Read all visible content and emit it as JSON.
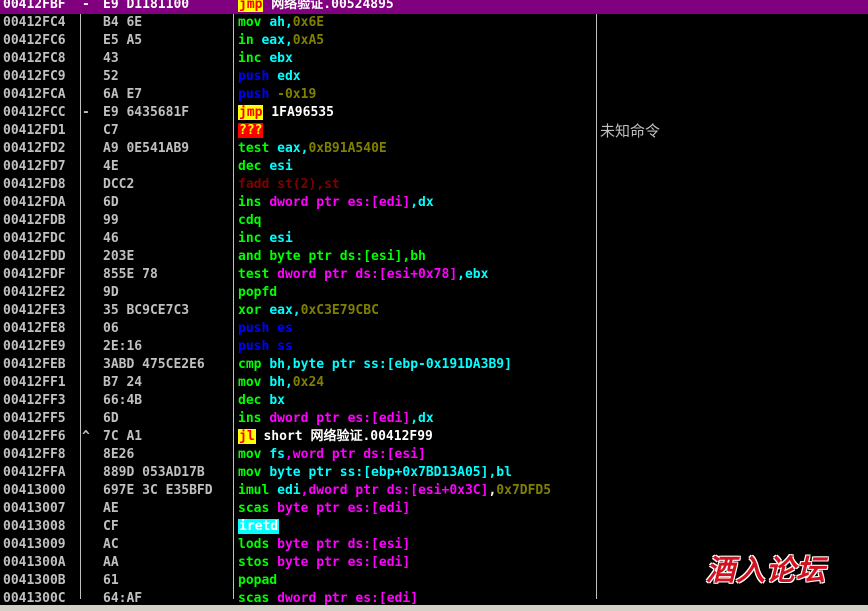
{
  "colors": {
    "background": "#000000",
    "selected_row": "#800080",
    "address": "#c0c0c0",
    "mnemonic_default": "#ffffff",
    "operand_register": "#00ffff",
    "operand_immediate": "#808000",
    "ptr_keyword": "#ff00ff",
    "push_pop": "#0000ff",
    "jump_highlight_bg": "#ffff00",
    "jump_highlight_fg": "#ff0000",
    "unknown_bg": "#ff0000",
    "unknown_fg": "#ffff00",
    "fpu": "#800000",
    "iretd_bg": "#00ffff",
    "iretd_fg": "#ffffff",
    "scas": "#00ff00",
    "watermark": "#d4111e"
  },
  "rows": [
    {
      "addr": "00412FBF",
      "mark": "-",
      "hex": "E9 D1181100",
      "selected": true,
      "ins": [
        {
          "t": "jmp",
          "c": "#ff0000",
          "bg": "#ffff00"
        },
        {
          "t": " 网络验证.00524895",
          "c": "#ffffff"
        }
      ],
      "cmt": ""
    },
    {
      "addr": "00412FC4",
      "mark": "",
      "hex": "B4 6E",
      "ins": [
        {
          "t": "mov ",
          "c": "#00ff00"
        },
        {
          "t": "ah",
          "c": "#00ffff"
        },
        {
          "t": ",",
          "c": "#00ffff"
        },
        {
          "t": "0x6E",
          "c": "#808000"
        }
      ],
      "cmt": ""
    },
    {
      "addr": "00412FC6",
      "mark": "",
      "hex": "E5 A5",
      "ins": [
        {
          "t": "in ",
          "c": "#00ff00"
        },
        {
          "t": "eax",
          "c": "#00ffff"
        },
        {
          "t": ",",
          "c": "#00ffff"
        },
        {
          "t": "0xA5",
          "c": "#808000"
        }
      ],
      "cmt": ""
    },
    {
      "addr": "00412FC8",
      "mark": "",
      "hex": "43",
      "ins": [
        {
          "t": "inc ",
          "c": "#00ff00"
        },
        {
          "t": "ebx",
          "c": "#00ffff"
        }
      ],
      "cmt": ""
    },
    {
      "addr": "00412FC9",
      "mark": "",
      "hex": "52",
      "ins": [
        {
          "t": "push ",
          "c": "#0000ff"
        },
        {
          "t": "edx",
          "c": "#00ffff"
        }
      ],
      "cmt": ""
    },
    {
      "addr": "00412FCA",
      "mark": "",
      "hex": "6A E7",
      "ins": [
        {
          "t": "push ",
          "c": "#0000ff"
        },
        {
          "t": "-0x19",
          "c": "#808000"
        }
      ],
      "cmt": ""
    },
    {
      "addr": "00412FCC",
      "mark": "-",
      "hex": "E9 6435681F",
      "ins": [
        {
          "t": "jmp",
          "c": "#ff0000",
          "bg": "#ffff00"
        },
        {
          "t": " 1FA96535",
          "c": "#ffffff"
        }
      ],
      "cmt": ""
    },
    {
      "addr": "00412FD1",
      "mark": "",
      "hex": "C7",
      "ins": [
        {
          "t": "???",
          "c": "#ffff00",
          "bg": "#ff0000"
        }
      ],
      "cmt": "未知命令"
    },
    {
      "addr": "00412FD2",
      "mark": "",
      "hex": "A9 0E541AB9",
      "ins": [
        {
          "t": "test ",
          "c": "#00ff00"
        },
        {
          "t": "eax",
          "c": "#00ffff"
        },
        {
          "t": ",",
          "c": "#00ffff"
        },
        {
          "t": "0xB91A540E",
          "c": "#808000"
        }
      ],
      "cmt": ""
    },
    {
      "addr": "00412FD7",
      "mark": "",
      "hex": "4E",
      "ins": [
        {
          "t": "dec ",
          "c": "#00ff00"
        },
        {
          "t": "esi",
          "c": "#00ffff"
        }
      ],
      "cmt": ""
    },
    {
      "addr": "00412FD8",
      "mark": "",
      "hex": "DCC2",
      "ins": [
        {
          "t": "fadd st(2),st",
          "c": "#800000"
        }
      ],
      "cmt": ""
    },
    {
      "addr": "00412FDA",
      "mark": "",
      "hex": "6D",
      "ins": [
        {
          "t": "ins ",
          "c": "#00ff00"
        },
        {
          "t": "dword ptr es:[edi]",
          "c": "#ff00ff"
        },
        {
          "t": ",dx",
          "c": "#00ffff"
        }
      ],
      "cmt": ""
    },
    {
      "addr": "00412FDB",
      "mark": "",
      "hex": "99",
      "ins": [
        {
          "t": "cdq",
          "c": "#00ff00"
        }
      ],
      "cmt": ""
    },
    {
      "addr": "00412FDC",
      "mark": "",
      "hex": "46",
      "ins": [
        {
          "t": "inc ",
          "c": "#00ff00"
        },
        {
          "t": "esi",
          "c": "#00ffff"
        }
      ],
      "cmt": ""
    },
    {
      "addr": "00412FDD",
      "mark": "",
      "hex": "203E",
      "ins": [
        {
          "t": "and ",
          "c": "#00ff00"
        },
        {
          "t": "byte ptr ds:[esi]",
          "c": "#00ff00"
        },
        {
          "t": ",bh",
          "c": "#00ff00"
        }
      ],
      "cmt": ""
    },
    {
      "addr": "00412FDF",
      "mark": "",
      "hex": "855E 78",
      "ins": [
        {
          "t": "test ",
          "c": "#00ff00"
        },
        {
          "t": "dword ptr ds:[esi+0x78]",
          "c": "#ff00ff"
        },
        {
          "t": ",ebx",
          "c": "#00ffff"
        }
      ],
      "cmt": ""
    },
    {
      "addr": "00412FE2",
      "mark": "",
      "hex": "9D",
      "ins": [
        {
          "t": "popfd",
          "c": "#00ff00"
        }
      ],
      "cmt": ""
    },
    {
      "addr": "00412FE3",
      "mark": "",
      "hex": "35 BC9CE7C3",
      "ins": [
        {
          "t": "xor ",
          "c": "#00ff00"
        },
        {
          "t": "eax",
          "c": "#00ffff"
        },
        {
          "t": ",",
          "c": "#00ffff"
        },
        {
          "t": "0xC3E79CBC",
          "c": "#808000"
        }
      ],
      "cmt": ""
    },
    {
      "addr": "00412FE8",
      "mark": "",
      "hex": "06",
      "ins": [
        {
          "t": "push ",
          "c": "#0000ff"
        },
        {
          "t": "es",
          "c": "#0000ff"
        }
      ],
      "cmt": ""
    },
    {
      "addr": "00412FE9",
      "mark": "",
      "hex": "2E:16",
      "ins": [
        {
          "t": "push ",
          "c": "#0000ff"
        },
        {
          "t": "ss",
          "c": "#0000ff"
        }
      ],
      "cmt": ""
    },
    {
      "addr": "00412FEB",
      "mark": "",
      "hex": "3ABD 475CE2E6",
      "ins": [
        {
          "t": "cmp ",
          "c": "#00ff00"
        },
        {
          "t": "bh",
          "c": "#00ffff"
        },
        {
          "t": ",byte ptr ss:[ebp-0x191DA3B9]",
          "c": "#00ffff"
        }
      ],
      "cmt": ""
    },
    {
      "addr": "00412FF1",
      "mark": "",
      "hex": "B7 24",
      "ins": [
        {
          "t": "mov ",
          "c": "#00ff00"
        },
        {
          "t": "bh",
          "c": "#00ffff"
        },
        {
          "t": ",",
          "c": "#00ffff"
        },
        {
          "t": "0x24",
          "c": "#808000"
        }
      ],
      "cmt": ""
    },
    {
      "addr": "00412FF3",
      "mark": "",
      "hex": "66:4B",
      "ins": [
        {
          "t": "dec ",
          "c": "#00ff00"
        },
        {
          "t": "bx",
          "c": "#00ffff"
        }
      ],
      "cmt": ""
    },
    {
      "addr": "00412FF5",
      "mark": "",
      "hex": "6D",
      "ins": [
        {
          "t": "ins ",
          "c": "#00ff00"
        },
        {
          "t": "dword ptr es:[edi]",
          "c": "#ff00ff"
        },
        {
          "t": ",dx",
          "c": "#00ffff"
        }
      ],
      "cmt": ""
    },
    {
      "addr": "00412FF6",
      "mark": "^",
      "hex": "7C A1",
      "ins": [
        {
          "t": "jl",
          "c": "#ff0000",
          "bg": "#ffff00"
        },
        {
          "t": " short 网络验证.00412F99",
          "c": "#ffffff"
        }
      ],
      "cmt": ""
    },
    {
      "addr": "00412FF8",
      "mark": "",
      "hex": "8E26",
      "ins": [
        {
          "t": "mov ",
          "c": "#00ff00"
        },
        {
          "t": "fs",
          "c": "#00ffff"
        },
        {
          "t": ",word ptr ds:[esi]",
          "c": "#ff00ff"
        }
      ],
      "cmt": ""
    },
    {
      "addr": "00412FFA",
      "mark": "",
      "hex": "889D 053AD17B",
      "ins": [
        {
          "t": "mov ",
          "c": "#00ff00"
        },
        {
          "t": "byte ptr ss:[ebp+0x7BD13A05]",
          "c": "#00ffff"
        },
        {
          "t": ",bl",
          "c": "#00ffff"
        }
      ],
      "cmt": ""
    },
    {
      "addr": "00413000",
      "mark": "",
      "hex": "697E 3C E35BFD",
      "ins": [
        {
          "t": "imul ",
          "c": "#00ff00"
        },
        {
          "t": "edi",
          "c": "#00ffff"
        },
        {
          "t": ",dword ptr ds:[esi+0x3C]",
          "c": "#ff00ff"
        },
        {
          "t": ",",
          "c": "#ffffff"
        },
        {
          "t": "0x7DFD5",
          "c": "#808000"
        }
      ],
      "cmt": ""
    },
    {
      "addr": "00413007",
      "mark": "",
      "hex": "AE",
      "ins": [
        {
          "t": "scas ",
          "c": "#00ff00"
        },
        {
          "t": "byte ptr es:[edi]",
          "c": "#ff00ff"
        }
      ],
      "cmt": ""
    },
    {
      "addr": "00413008",
      "mark": "",
      "hex": "CF",
      "ins": [
        {
          "t": "iretd",
          "c": "#ffffff",
          "bg": "#00ffff"
        }
      ],
      "cmt": ""
    },
    {
      "addr": "00413009",
      "mark": "",
      "hex": "AC",
      "ins": [
        {
          "t": "lods ",
          "c": "#00ff00"
        },
        {
          "t": "byte ptr ds:[esi]",
          "c": "#ff00ff"
        }
      ],
      "cmt": ""
    },
    {
      "addr": "0041300A",
      "mark": "",
      "hex": "AA",
      "ins": [
        {
          "t": "stos ",
          "c": "#00ff00"
        },
        {
          "t": "byte ptr es:[edi]",
          "c": "#ff00ff"
        }
      ],
      "cmt": ""
    },
    {
      "addr": "0041300B",
      "mark": "",
      "hex": "61",
      "ins": [
        {
          "t": "popad",
          "c": "#00ff00"
        }
      ],
      "cmt": ""
    },
    {
      "addr": "0041300C",
      "mark": "",
      "hex": "64:AF",
      "ins": [
        {
          "t": "scas ",
          "c": "#00ff00"
        },
        {
          "t": "dword ptr es:[edi]",
          "c": "#ff00ff"
        }
      ],
      "cmt": ""
    }
  ],
  "watermark": "酒入论坛"
}
